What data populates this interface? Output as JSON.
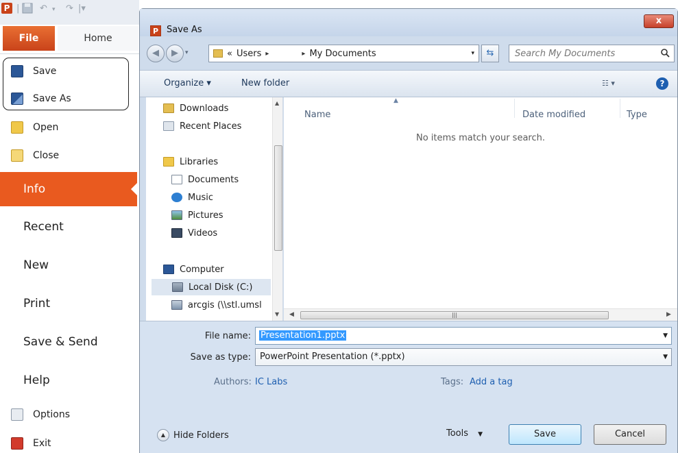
{
  "backstage": {
    "app_icon": "P",
    "tabs": {
      "file": "File",
      "home": "Home"
    },
    "commands": [
      {
        "label": "Save",
        "icon": "save-icon"
      },
      {
        "label": "Save As",
        "icon": "save-as-icon"
      },
      {
        "label": "Open",
        "icon": "open-folder-icon"
      },
      {
        "label": "Close",
        "icon": "close-folder-icon"
      }
    ],
    "sections": [
      "Info",
      "Recent",
      "New",
      "Print",
      "Save & Send",
      "Help"
    ],
    "bottom_commands": [
      {
        "label": "Options",
        "icon": "options-icon"
      },
      {
        "label": "Exit",
        "icon": "exit-icon"
      }
    ],
    "selected_section": "Info"
  },
  "dialog": {
    "title": "Save As",
    "title_icon": "P",
    "close_label": "x",
    "breadcrumb": {
      "overflow": "«",
      "items": [
        "Users",
        "",
        "My Documents"
      ]
    },
    "search_placeholder": "Search My Documents",
    "toolbar": {
      "organize": "Organize ▾",
      "new_folder": "New folder",
      "help": "?"
    },
    "nav": {
      "items": [
        "Downloads",
        "Recent Places",
        "Libraries",
        "Documents",
        "Music",
        "Pictures",
        "Videos",
        "Computer",
        "Local Disk (C:)",
        "arcgis (\\\\stl.umsl"
      ],
      "selected": "Local Disk (C:)"
    },
    "columns": [
      "Name",
      "Date modified",
      "Type"
    ],
    "empty_message": "No items match your search.",
    "form": {
      "file_name_label": "File name:",
      "file_name_value": "Presentation1.pptx",
      "save_type_label": "Save as type:",
      "save_type_value": "PowerPoint Presentation (*.pptx)",
      "authors_label": "Authors:",
      "authors_value": "IC Labs",
      "tags_label": "Tags:",
      "tags_value": "Add a tag"
    },
    "buttons": {
      "hide_folders": "Hide Folders",
      "tools": "Tools",
      "save": "Save",
      "cancel": "Cancel"
    }
  },
  "colors": {
    "accent_orange": "#e95a1f",
    "dialog_bg": "#d6e2f1",
    "link_blue": "#1e5fb0"
  }
}
